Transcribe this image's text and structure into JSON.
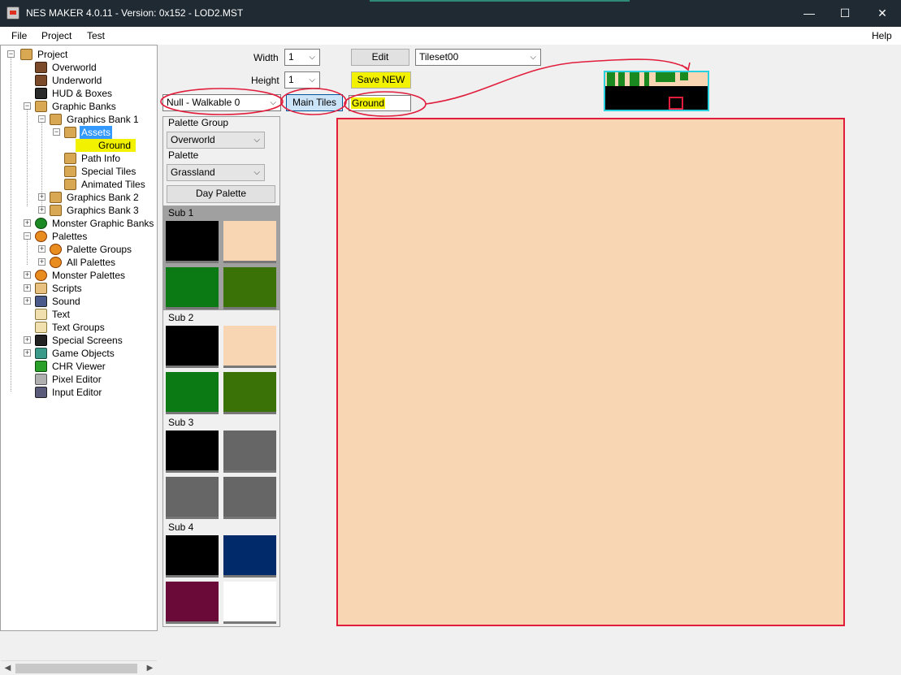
{
  "window": {
    "title": "NES MAKER 4.0.11 - Version: 0x152 - LOD2.MST",
    "minimize_glyph": "—",
    "maximize_glyph": "☐",
    "close_glyph": "✕"
  },
  "menu": {
    "file": "File",
    "project": "Project",
    "test": "Test",
    "help": "Help"
  },
  "tree": {
    "project": "Project",
    "overworld": "Overworld",
    "underworld": "Underworld",
    "hud": "HUD & Boxes",
    "graphic_banks": "Graphic Banks",
    "graphics_bank_1": "Graphics Bank 1",
    "assets": "Assets",
    "ground": "Ground",
    "path_info": "Path Info",
    "special_tiles": "Special Tiles",
    "animated_tiles": "Animated Tiles",
    "graphics_bank_2": "Graphics Bank 2",
    "graphics_bank_3": "Graphics Bank 3",
    "monster_graphic_banks": "Monster Graphic Banks",
    "palettes": "Palettes",
    "palette_groups": "Palette Groups",
    "all_palettes": "All Palettes",
    "monster_palettes": "Monster Palettes",
    "scripts": "Scripts",
    "sound": "Sound",
    "text": "Text",
    "text_groups": "Text Groups",
    "special_screens": "Special Screens",
    "game_objects": "Game Objects",
    "chr_viewer": "CHR Viewer",
    "pixel_editor": "Pixel Editor",
    "input_editor": "Input Editor"
  },
  "form": {
    "width_label": "Width",
    "width_value": "1",
    "height_label": "Height",
    "height_value": "1",
    "edit_button": "Edit",
    "tileset_value": "Tileset00",
    "save_new_button": "Save NEW",
    "collision_value": "Null - Walkable 0",
    "main_tiles_button": "Main Tiles",
    "name_value": "Ground"
  },
  "palette_panel": {
    "palette_group_label": "Palette Group",
    "palette_group_value": "Overworld",
    "palette_label": "Palette",
    "palette_value": "Grassland",
    "day_palette_button": "Day Palette",
    "subs": [
      {
        "label": "Sub 1",
        "colors": [
          "#000000",
          "#f8d5b3",
          "#0b7a14",
          "#3a7208"
        ]
      },
      {
        "label": "Sub 2",
        "colors": [
          "#000000",
          "#f8d5b3",
          "#0b7a14",
          "#3a7208"
        ]
      },
      {
        "label": "Sub 3",
        "colors": [
          "#000000",
          "#666666",
          "#666666",
          "#666666"
        ]
      },
      {
        "label": "Sub 4",
        "colors": [
          "#000000",
          "#002a6a",
          "#6a0a38",
          "#ffffff"
        ]
      }
    ]
  },
  "colors": {
    "canvas_fill": "#f8d5b3",
    "annotation_red": "#e11d3c",
    "highlight_yellow": "#f2f200",
    "selection_blue": "#3399ff"
  }
}
